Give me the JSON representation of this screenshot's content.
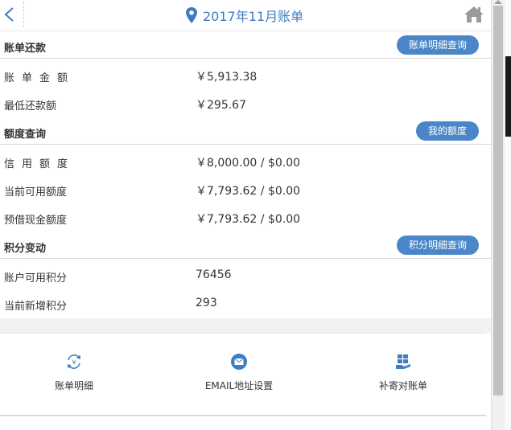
{
  "header": {
    "title": "2017年11月账单",
    "back_icon": "chevron-left-icon",
    "location_icon": "map-pin-icon",
    "home_icon": "home-icon",
    "accent": "#3f7cc0"
  },
  "repayment": {
    "heading": "账单还款",
    "button": "账单明细查询",
    "rows": [
      {
        "label": "账单金额",
        "value": "￥5,913.38"
      },
      {
        "label": "最低还款额",
        "value": "￥295.67"
      }
    ]
  },
  "credit": {
    "heading": "额度查询",
    "button": "我的额度",
    "rows": [
      {
        "label": "信用额度",
        "value": "￥8,000.00 / $0.00"
      },
      {
        "label": "当前可用额度",
        "value": "￥7,793.62 / $0.00"
      },
      {
        "label": "预借现金额度",
        "value": "￥7,793.62 / $0.00"
      }
    ]
  },
  "points": {
    "heading": "积分变动",
    "button": "积分明细查询",
    "rows": [
      {
        "label": "账户可用积分",
        "value": "76456"
      },
      {
        "label": "当前新增积分",
        "value": "293"
      }
    ]
  },
  "shortcuts": [
    {
      "label": "账单明细",
      "icon": "refresh-yen-icon"
    },
    {
      "label": "EMAIL地址设置",
      "icon": "email-icon"
    },
    {
      "label": "补寄对账单",
      "icon": "document-hand-icon"
    }
  ],
  "colors": {
    "button": "#4a86c8",
    "icon": "#3f7cc0"
  }
}
